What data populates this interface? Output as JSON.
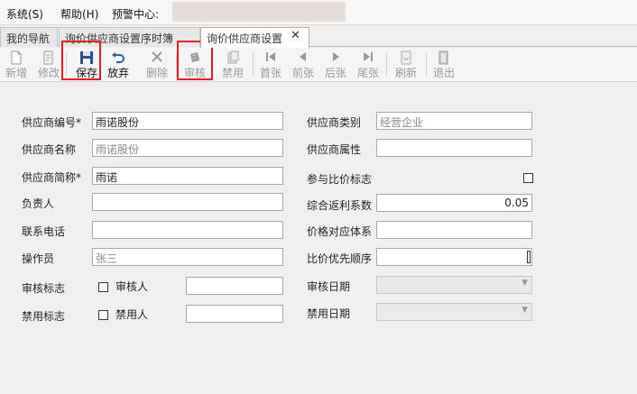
{
  "menubar": {
    "items": [
      "系统(S)",
      "帮助(H)",
      "预警中心:"
    ]
  },
  "tabs": {
    "items": [
      "我的导航",
      "询价供应商设置序时簿",
      "询价供应商设置"
    ],
    "close_glyph": "✕"
  },
  "toolbar": {
    "buttons": [
      {
        "label": "新增",
        "icon": "new-doc-icon",
        "enabled": false
      },
      {
        "label": "修改",
        "icon": "edit-doc-icon",
        "enabled": false
      },
      {
        "label": "保存",
        "icon": "save-icon",
        "enabled": true
      },
      {
        "label": "放弃",
        "icon": "undo-icon",
        "enabled": true
      },
      {
        "label": "删除",
        "icon": "delete-icon",
        "enabled": false
      },
      {
        "label": "审核",
        "icon": "audit-icon",
        "enabled": false
      },
      {
        "label": "禁用",
        "icon": "disable-icon",
        "enabled": false
      },
      {
        "label": "首张",
        "icon": "first-icon",
        "enabled": false
      },
      {
        "label": "前张",
        "icon": "prev-icon",
        "enabled": false
      },
      {
        "label": "后张",
        "icon": "next-icon",
        "enabled": false
      },
      {
        "label": "尾张",
        "icon": "last-icon",
        "enabled": false
      },
      {
        "label": "刷新",
        "icon": "refresh-icon",
        "enabled": false
      },
      {
        "label": "退出",
        "icon": "exit-icon",
        "enabled": false
      }
    ],
    "highlight_color": "#e02020"
  },
  "form": {
    "left": {
      "supplier_code": {
        "label": "供应商编号*",
        "value": "雨诺股份"
      },
      "supplier_name": {
        "label": "供应商名称",
        "value": "雨诺股份"
      },
      "supplier_short": {
        "label": "供应商简称*",
        "value": "雨诺"
      },
      "owner": {
        "label": "负责人",
        "value": ""
      },
      "phone": {
        "label": "联系电话",
        "value": ""
      },
      "operator": {
        "label": "操作员",
        "value": "张三"
      },
      "audit_flag": {
        "label": "审核标志",
        "person_label": "审核人",
        "value": ""
      },
      "disable_flag": {
        "label": "禁用标志",
        "person_label": "禁用人",
        "value": ""
      }
    },
    "right": {
      "category": {
        "label": "供应商类别",
        "value": "经营企业"
      },
      "attribute": {
        "label": "供应商属性",
        "value": ""
      },
      "compare_flag": {
        "label": "参与比价标志"
      },
      "rebate": {
        "label": "综合返利系数",
        "value": "0.05"
      },
      "price_system": {
        "label": "价格对应体系",
        "value": ""
      },
      "priority": {
        "label": "比价优先顺序",
        "value": ""
      },
      "audit_date": {
        "label": "审核日期"
      },
      "disable_date": {
        "label": "禁用日期"
      }
    }
  }
}
